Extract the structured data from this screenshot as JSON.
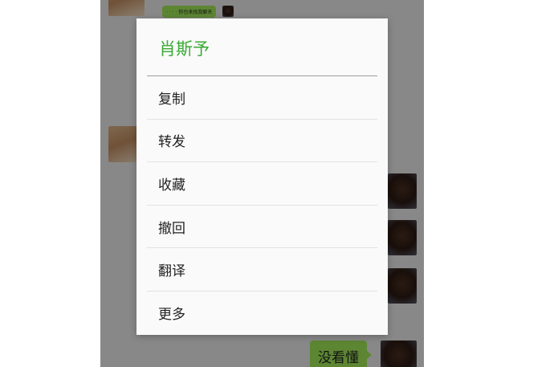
{
  "dialog": {
    "title": "肖斯予",
    "items": [
      {
        "label": "复制"
      },
      {
        "label": "转发"
      },
      {
        "label": "收藏"
      },
      {
        "label": "撤回"
      },
      {
        "label": "翻译"
      },
      {
        "label": "更多"
      }
    ]
  },
  "chat": {
    "top_small_message": "· · · · 你也来找我聊天",
    "last_message": "没看懂"
  },
  "colors": {
    "accent": "#3aaa35",
    "bubble_green": "#a0e759",
    "overlay": "rgba(0,0,0,0.42)"
  }
}
